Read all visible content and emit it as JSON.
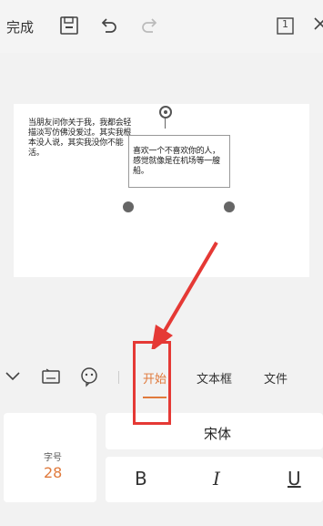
{
  "toolbar": {
    "done_label": "完成",
    "page_count": "1"
  },
  "document": {
    "left_text": "当朋友问你关于我，我都会轻描淡写仿佛没爱过。其实我根本没人说，其实我没你不能活。",
    "textbox_text": "喜欢一个不喜欢你的人，感觉就像是在机场等一艘船。"
  },
  "tabs": {
    "start": "开始",
    "textbox": "文本框",
    "file": "文件"
  },
  "format_panel": {
    "font_size_label": "字号",
    "font_size_value": "28",
    "font_name": "宋体",
    "bold": "B",
    "italic": "I",
    "underline": "U"
  },
  "colors": {
    "accent": "#e07a3c",
    "annotation": "#e53935"
  }
}
